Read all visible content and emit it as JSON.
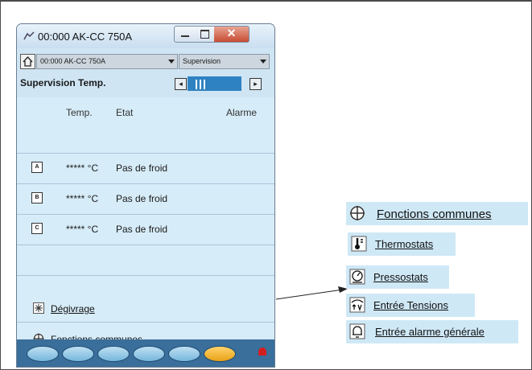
{
  "window": {
    "title": "00:000 AK-CC 750A",
    "combo_device": "00:000 AK-CC 750A",
    "combo_view": "Supervision",
    "page_title": "Supervision Temp.",
    "columns": {
      "temp": "Temp.",
      "state": "Etat",
      "alarm": "Alarme"
    },
    "rows": [
      {
        "zone": "A",
        "temp": "***** °C",
        "state": "Pas de froid"
      },
      {
        "zone": "B",
        "temp": "***** °C",
        "state": "Pas de froid"
      },
      {
        "zone": "C",
        "temp": "***** °C",
        "state": "Pas de froid"
      }
    ],
    "links": {
      "defrost": "Dégivrage",
      "common": "Fonctions communes"
    },
    "toolbar": [
      "display-icon",
      "keypad-icon",
      "fan-icon",
      "graph-icon",
      "alarm-bell-icon",
      "tool-icon"
    ],
    "active_tool": "tool-icon"
  },
  "menu": {
    "items": [
      {
        "label": "Fonctions communes",
        "icon": "crosshair-icon"
      },
      {
        "label": "Thermostats",
        "icon": "thermostat-icon"
      },
      {
        "label": "Pressostats",
        "icon": "pressure-switch-icon"
      },
      {
        "label": "Entrée Tensions",
        "icon": "voltage-input-icon"
      },
      {
        "label": "Entrée alarme générale",
        "icon": "general-alarm-icon"
      }
    ]
  },
  "colors": {
    "panel": "#d6ecf8",
    "selection": "#2f82c2",
    "toolbar": "#3a6e9b",
    "alarm": "#d41e1e"
  }
}
